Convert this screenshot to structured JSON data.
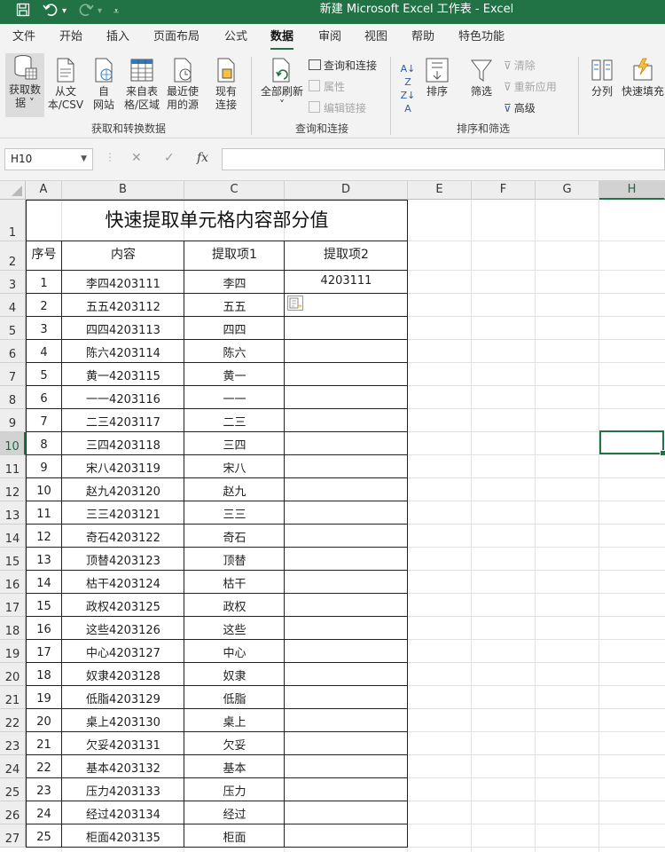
{
  "window": {
    "title": "新建 Microsoft Excel 工作表  -  Excel"
  },
  "quick_access": {
    "save_icon": "save-icon",
    "undo_icon": "undo-icon",
    "redo_icon": "redo-icon",
    "customize_icon": "customize-icon"
  },
  "tabs": [
    "文件",
    "开始",
    "插入",
    "页面布局",
    "公式",
    "数据",
    "审阅",
    "视图",
    "帮助",
    "特色功能"
  ],
  "active_tab": "数据",
  "ribbon": {
    "get_data": {
      "line1": "获取数",
      "line2": "据 ˅"
    },
    "from_text": {
      "line1": "从文",
      "line2": "本/CSV"
    },
    "from_web": {
      "line1": "自",
      "line2": "网站"
    },
    "from_table": {
      "line1": "来自表",
      "line2": "格/区域"
    },
    "recent_sources": {
      "line1": "最近使",
      "line2": "用的源"
    },
    "existing_conn": {
      "line1": "现有",
      "line2": "连接"
    },
    "group1": "获取和转换数据",
    "refresh_all": {
      "line1": "全部刷新",
      "line2": "˅"
    },
    "queries_conn": "查询和连接",
    "properties": "属性",
    "edit_links": "编辑链接",
    "group2": "查询和连接",
    "sort": "排序",
    "filter": "筛选",
    "clear": "清除",
    "reapply": "重新应用",
    "advanced": "高级",
    "group3": "排序和筛选",
    "text_to_columns": "分列",
    "flash_fill": "快速填充"
  },
  "formula_bar": {
    "name_box": "H10",
    "cancel": "✕",
    "enter": "✓",
    "fx": "fx",
    "value": ""
  },
  "columns": [
    "A",
    "B",
    "C",
    "D",
    "E",
    "F",
    "G",
    "H"
  ],
  "selected_cell": "H10",
  "sheet": {
    "title": "快速提取单元格内容部分值",
    "headers": [
      "序号",
      "内容",
      "提取项1",
      "提取项2"
    ],
    "rows": [
      {
        "n": "1",
        "content": "李四4203111",
        "item1": "李四",
        "item2": "4203111"
      },
      {
        "n": "2",
        "content": "五五4203112",
        "item1": "五五",
        "item2": ""
      },
      {
        "n": "3",
        "content": "四四4203113",
        "item1": "四四",
        "item2": ""
      },
      {
        "n": "4",
        "content": "陈六4203114",
        "item1": "陈六",
        "item2": ""
      },
      {
        "n": "5",
        "content": "黄一4203115",
        "item1": "黄一",
        "item2": ""
      },
      {
        "n": "6",
        "content": "一一4203116",
        "item1": "一一",
        "item2": ""
      },
      {
        "n": "7",
        "content": "二三4203117",
        "item1": "二三",
        "item2": ""
      },
      {
        "n": "8",
        "content": "三四4203118",
        "item1": "三四",
        "item2": ""
      },
      {
        "n": "9",
        "content": "宋八4203119",
        "item1": "宋八",
        "item2": ""
      },
      {
        "n": "10",
        "content": "赵九4203120",
        "item1": "赵九",
        "item2": ""
      },
      {
        "n": "11",
        "content": "三三4203121",
        "item1": "三三",
        "item2": ""
      },
      {
        "n": "12",
        "content": "奇石4203122",
        "item1": "奇石",
        "item2": ""
      },
      {
        "n": "13",
        "content": "顶替4203123",
        "item1": "顶替",
        "item2": ""
      },
      {
        "n": "14",
        "content": "枯干4203124",
        "item1": "枯干",
        "item2": ""
      },
      {
        "n": "15",
        "content": "政权4203125",
        "item1": "政权",
        "item2": ""
      },
      {
        "n": "16",
        "content": "这些4203126",
        "item1": "这些",
        "item2": ""
      },
      {
        "n": "17",
        "content": "中心4203127",
        "item1": "中心",
        "item2": ""
      },
      {
        "n": "18",
        "content": "奴隶4203128",
        "item1": "奴隶",
        "item2": ""
      },
      {
        "n": "19",
        "content": "低脂4203129",
        "item1": "低脂",
        "item2": ""
      },
      {
        "n": "20",
        "content": "桌上4203130",
        "item1": "桌上",
        "item2": ""
      },
      {
        "n": "21",
        "content": "欠妥4203131",
        "item1": "欠妥",
        "item2": ""
      },
      {
        "n": "22",
        "content": "基本4203132",
        "item1": "基本",
        "item2": ""
      },
      {
        "n": "23",
        "content": "压力4203133",
        "item1": "压力",
        "item2": ""
      },
      {
        "n": "24",
        "content": "经过4203134",
        "item1": "经过",
        "item2": ""
      },
      {
        "n": "25",
        "content": "柜面4203135",
        "item1": "柜面",
        "item2": ""
      }
    ]
  },
  "row_numbers": [
    "1",
    "2",
    "3",
    "4",
    "5",
    "6",
    "7",
    "8",
    "9",
    "10",
    "11",
    "12",
    "13",
    "14",
    "15",
    "16",
    "17",
    "18",
    "19",
    "20",
    "21",
    "22",
    "23",
    "24",
    "25",
    "26",
    "27"
  ],
  "colors": {
    "accent": "#217346",
    "title_bar": "#217346"
  }
}
